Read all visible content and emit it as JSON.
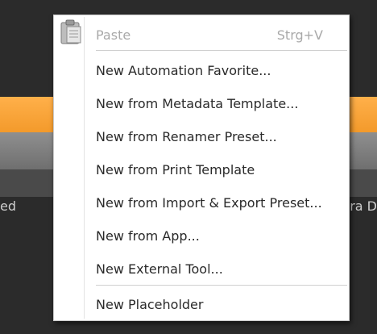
{
  "background": {
    "left_text": "ed",
    "right_text": "ra D"
  },
  "menu": {
    "items": [
      {
        "label": "Paste",
        "shortcut": "Strg+V",
        "enabled": false,
        "icon": "clipboard-icon"
      },
      {
        "label": "New Automation Favorite..."
      },
      {
        "label": "New from Metadata Template..."
      },
      {
        "label": "New from Renamer Preset..."
      },
      {
        "label": "New from Print Template"
      },
      {
        "label": "New from Import & Export Preset..."
      },
      {
        "label": "New from App..."
      },
      {
        "label": "New External Tool..."
      },
      {
        "label": "New Placeholder"
      }
    ]
  }
}
